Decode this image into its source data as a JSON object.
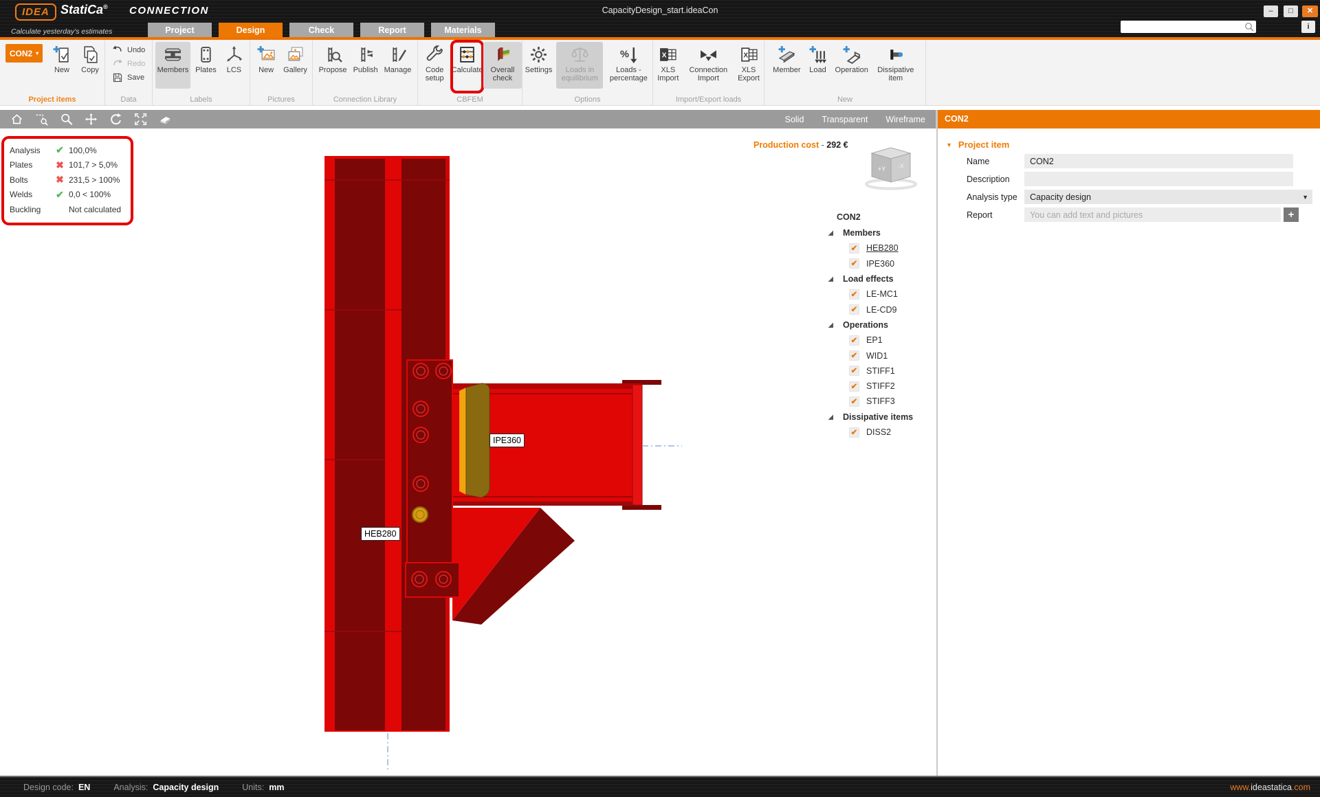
{
  "titlebar": {
    "logo_idea": "IDEA",
    "logo_statica": "StatiCa",
    "logo_reg": "®",
    "app_name": "CONNECTION",
    "tagline": "Calculate yesterday's estimates",
    "document_title": "CapacityDesign_start.ideaCon",
    "window_buttons": [
      "minimize",
      "maximize",
      "close"
    ]
  },
  "search": {
    "value": ""
  },
  "info_button": {
    "label": "i"
  },
  "tabs": [
    {
      "label": "Project",
      "active": false
    },
    {
      "label": "Design",
      "active": true
    },
    {
      "label": "Check",
      "active": false
    },
    {
      "label": "Report",
      "active": false
    },
    {
      "label": "Materials",
      "active": false
    }
  ],
  "ribbon": {
    "groups": [
      {
        "label": "Project items",
        "accent": true,
        "buttons": [
          {
            "label": "CON2",
            "style": "dropdown",
            "caret": "▾"
          },
          {
            "label": "New",
            "icon": "new-item"
          },
          {
            "label": "Copy",
            "icon": "copy"
          }
        ]
      },
      {
        "label": "Data",
        "layout": "stack",
        "buttons": [
          {
            "label": "Undo",
            "icon": "undo"
          },
          {
            "label": "Redo",
            "icon": "redo",
            "disabled": true
          },
          {
            "label": "Save",
            "icon": "save"
          }
        ]
      },
      {
        "label": "Labels",
        "buttons": [
          {
            "label": "Members",
            "icon": "members",
            "selected": true
          },
          {
            "label": "Plates",
            "icon": "plates"
          },
          {
            "label": "LCS",
            "icon": "lcs"
          }
        ]
      },
      {
        "label": "Pictures",
        "buttons": [
          {
            "label": "New",
            "icon": "new-picture"
          },
          {
            "label": "Gallery",
            "icon": "gallery"
          }
        ]
      },
      {
        "label": "Connection Library",
        "buttons": [
          {
            "label": "Propose",
            "icon": "propose"
          },
          {
            "label": "Publish",
            "icon": "publish"
          },
          {
            "label": "Manage",
            "icon": "manage"
          }
        ]
      },
      {
        "label": "CBFEM",
        "buttons": [
          {
            "label": "Code setup",
            "icon": "code-setup"
          },
          {
            "label": "Calculate",
            "icon": "calculate",
            "highlighted": true
          },
          {
            "label": "Overall check",
            "icon": "overall-check",
            "selected": true
          }
        ]
      },
      {
        "label": "Options",
        "buttons": [
          {
            "label": "Settings",
            "icon": "settings"
          },
          {
            "label": "Loads in equilibrium",
            "icon": "loads-equilibrium",
            "disabled": true,
            "selected": true
          },
          {
            "label": "Loads - percentage",
            "icon": "loads-percentage"
          }
        ]
      },
      {
        "label": "Import/Export loads",
        "buttons": [
          {
            "label": "XLS Import",
            "icon": "xls-import"
          },
          {
            "label": "Connection Import",
            "icon": "connection-import"
          },
          {
            "label": "XLS Export",
            "icon": "xls-export"
          }
        ]
      },
      {
        "label": "New",
        "buttons": [
          {
            "label": "Member",
            "icon": "member-add"
          },
          {
            "label": "Load",
            "icon": "load-add"
          },
          {
            "label": "Operation",
            "icon": "operation-add"
          },
          {
            "label": "Dissipative item",
            "icon": "dissipative-add"
          }
        ]
      }
    ]
  },
  "viewport_toolbar": {
    "tools": [
      "home",
      "zoom-window",
      "zoom",
      "pan",
      "rotate",
      "fit",
      "eraser"
    ],
    "view_modes": [
      "Solid",
      "Transparent",
      "Wireframe"
    ]
  },
  "analysis_panel": {
    "rows": [
      {
        "label": "Analysis",
        "status": "pass",
        "value": "100,0%"
      },
      {
        "label": "Plates",
        "status": "fail",
        "value": "101,7 > 5,0%"
      },
      {
        "label": "Bolts",
        "status": "fail",
        "value": "231,5 > 100%"
      },
      {
        "label": "Welds",
        "status": "pass",
        "value": "0,0 < 100%"
      },
      {
        "label": "Buckling",
        "status": "none",
        "value": "Not calculated"
      }
    ]
  },
  "viewport": {
    "production_cost_label": "Production cost",
    "production_cost_separator": "-",
    "production_cost_value": "292 €",
    "member_labels": {
      "beam": "IPE360",
      "column": "HEB280"
    },
    "nav_cube": {
      "front_face": "+Y",
      "right_face": "-X"
    }
  },
  "tree": {
    "title": "CON2",
    "sections": [
      {
        "label": "Members",
        "items": [
          {
            "label": "HEB280",
            "checked": true,
            "underlined": true
          },
          {
            "label": "IPE360",
            "checked": true
          }
        ]
      },
      {
        "label": "Load effects",
        "items": [
          {
            "label": "LE-MC1",
            "checked": true
          },
          {
            "label": "LE-CD9",
            "checked": true
          }
        ]
      },
      {
        "label": "Operations",
        "items": [
          {
            "label": "EP1",
            "checked": true
          },
          {
            "label": "WID1",
            "checked": true
          },
          {
            "label": "STIFF1",
            "checked": true
          },
          {
            "label": "STIFF2",
            "checked": true
          },
          {
            "label": "STIFF3",
            "checked": true
          }
        ]
      },
      {
        "label": "Dissipative items",
        "items": [
          {
            "label": "DISS2",
            "checked": true
          }
        ]
      }
    ]
  },
  "properties": {
    "header": "CON2",
    "section_title": "Project item",
    "fields": {
      "name": {
        "label": "Name",
        "value": "CON2"
      },
      "description": {
        "label": "Description",
        "value": ""
      },
      "analysis_type": {
        "label": "Analysis type",
        "value": "Capacity design"
      },
      "report": {
        "label": "Report",
        "placeholder": "You can add text and pictures"
      }
    }
  },
  "statusbar": {
    "items": [
      {
        "label": "Design code:",
        "value": "EN"
      },
      {
        "label": "Analysis:",
        "value": "Capacity design"
      },
      {
        "label": "Units:",
        "value": "mm"
      }
    ],
    "website": {
      "prefix": "www.",
      "name": "ideastatica",
      "suffix": ".com"
    }
  },
  "colors": {
    "accent_orange": "#ed7703",
    "highlight_red": "#e60000",
    "model_red": "#e00606",
    "model_dark_red": "#7c0707",
    "dissipative_yellow": "#8a6a10",
    "pass_green": "#58b858",
    "fail_red": "#ef5350"
  }
}
